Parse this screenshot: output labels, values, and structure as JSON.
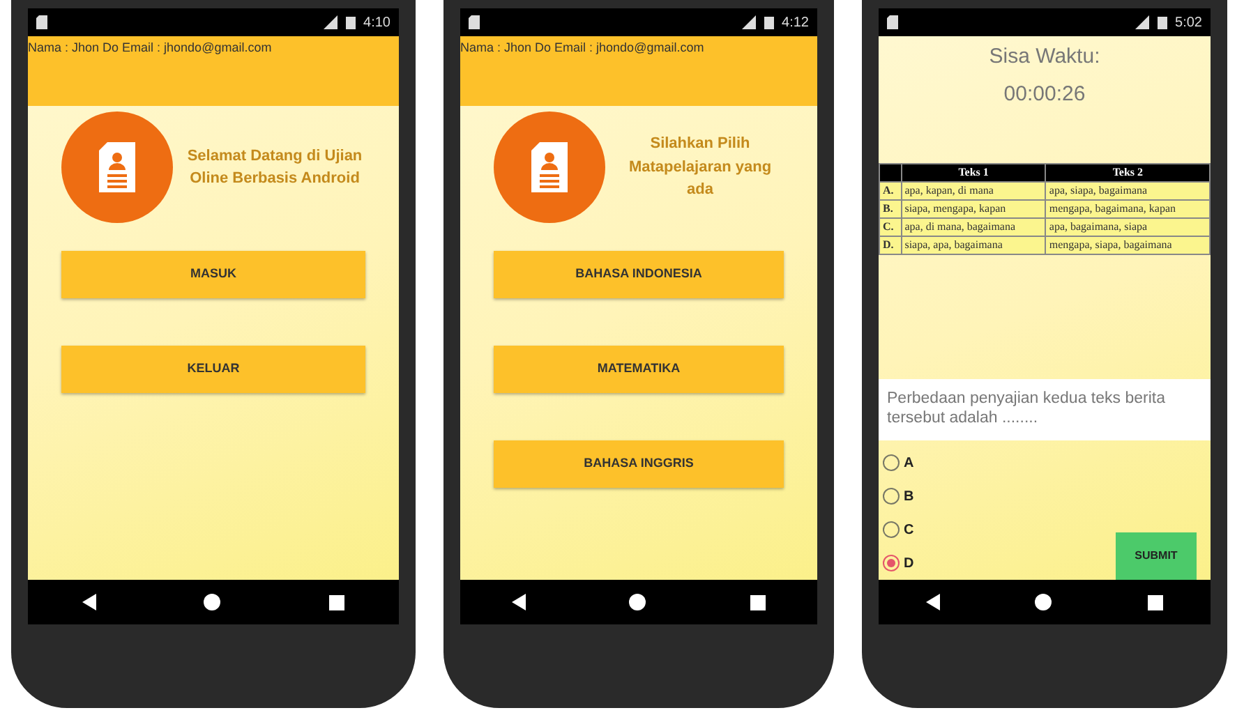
{
  "phones": [
    {
      "kind": "menu",
      "status_time": "4:10",
      "header": "Nama : Jhon Do Email : jhondo@gmail.com",
      "title": "Selamat Datang di Ujian Oline Berbasis Android",
      "buttons": [
        "MASUK",
        "KELUAR"
      ]
    },
    {
      "kind": "menu",
      "status_time": "4:12",
      "header": "Nama : Jhon Do Email : jhondo@gmail.com",
      "title": "Silahkan Pilih Matapelajaran yang ada",
      "buttons": [
        "BAHASA INDONESIA",
        "MATEMATIKA",
        "BAHASA INGGRIS"
      ]
    },
    {
      "kind": "quiz",
      "status_time": "5:02",
      "timer_label": "Sisa Waktu:",
      "timer": "00:00:26",
      "table": {
        "columns": [
          "Teks 1",
          "Teks 2"
        ],
        "rows": [
          {
            "label": "A.",
            "teks_1": "apa, kapan, di mana",
            "teks_2": "apa, siapa, bagaimana"
          },
          {
            "label": "B.",
            "teks_1": "siapa, mengapa, kapan",
            "teks_2": "mengapa, bagaimana, kapan"
          },
          {
            "label": "C.",
            "teks_1": "apa, di mana, bagaimana",
            "teks_2": "apa, bagaimana, siapa"
          },
          {
            "label": "D.",
            "teks_1": "siapa, apa, bagaimana",
            "teks_2": "mengapa, siapa, bagaimana"
          }
        ]
      },
      "question": "Perbedaan penyajian kedua teks berita tersebut adalah ........",
      "options": [
        {
          "label": "A",
          "selected": false
        },
        {
          "label": "B",
          "selected": false
        },
        {
          "label": "C",
          "selected": false
        },
        {
          "label": "D",
          "selected": true
        }
      ],
      "submit": "SUBMIT"
    }
  ]
}
